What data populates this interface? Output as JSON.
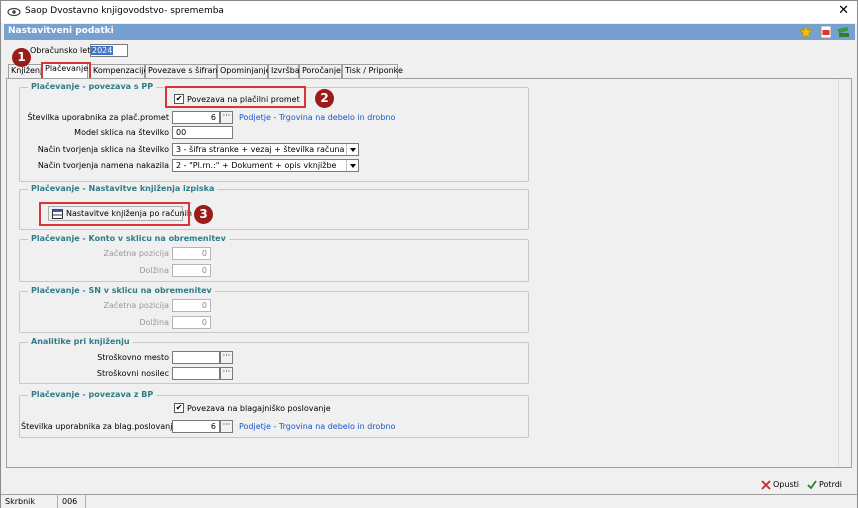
{
  "window": {
    "title": "Saop Dvostavno knjigovodstvo- sprememba",
    "close": "✕"
  },
  "header": {
    "title": "Nastavitveni podatki"
  },
  "year": {
    "label": "Obračunsko leto",
    "value": "2024"
  },
  "tabs": [
    {
      "label": "Knjiženje"
    },
    {
      "label": "Plačevanje"
    },
    {
      "label": "Kompenzacije"
    },
    {
      "label": "Povezave s šifranti"
    },
    {
      "label": "Opominjanje"
    },
    {
      "label": "Izvršba"
    },
    {
      "label": "Poročanje"
    },
    {
      "label": "Tisk / Priponke"
    }
  ],
  "pp": {
    "title": "Plačevanje - povezava s PP",
    "checkbox_label": "Povezava na plačilni promet",
    "user_label": "Številka uporabnika za plač.promet",
    "user_value": "6",
    "user_link": "Podjetje - Trgovina na debelo in drobno",
    "model_label": "Model sklica na številko",
    "model_value": "00",
    "sklic_label": "Način tvorjenja sklica na številko",
    "sklic_value": "3 - šifra stranke + vezaj + številka računa",
    "namen_label": "Način tvorjenja namena nakazila",
    "namen_value": "2 - \"Pl.rn.:\" + Dokument + opis vknjižbe"
  },
  "izpisek": {
    "title": "Plačevanje - Nastavitve knjiženja izpiska",
    "button_label": "Nastavitve knjiženja po računih"
  },
  "konto": {
    "title": "Plačevanje - Konto v sklicu na obremenitev",
    "start_label": "Začetna pozicija",
    "start_value": "0",
    "len_label": "Dolžina",
    "len_value": "0"
  },
  "sn": {
    "title": "Plačevanje - SN v sklicu na obremenitev",
    "start_label": "Začetna pozicija",
    "start_value": "0",
    "len_label": "Dolžina",
    "len_value": "0"
  },
  "analitike": {
    "title": "Analitike pri knjiženju",
    "sm_label": "Stroškovno mesto",
    "sm_value": "",
    "sn_label": "Stroškovni nosilec",
    "sn_value": ""
  },
  "bp": {
    "title": "Plačevanje - povezava z BP",
    "checkbox_label": "Povezava na blagajniško poslovanje",
    "user_label": "Številka uporabnika za blag.poslovanje",
    "user_value": "6",
    "user_link": "Podjetje - Trgovina na debelo in drobno"
  },
  "badges": {
    "one": "1",
    "two": "2",
    "three": "3"
  },
  "actions": {
    "cancel": "Opusti",
    "confirm": "Potrdi"
  },
  "status": {
    "user_label": "Skrbnik",
    "code": "006"
  },
  "colors": {
    "header": "#76a0cf",
    "group_title": "#2f7d86",
    "link": "#1a56c8",
    "highlight": "#d9343a",
    "badge": "#9b1b1b"
  }
}
